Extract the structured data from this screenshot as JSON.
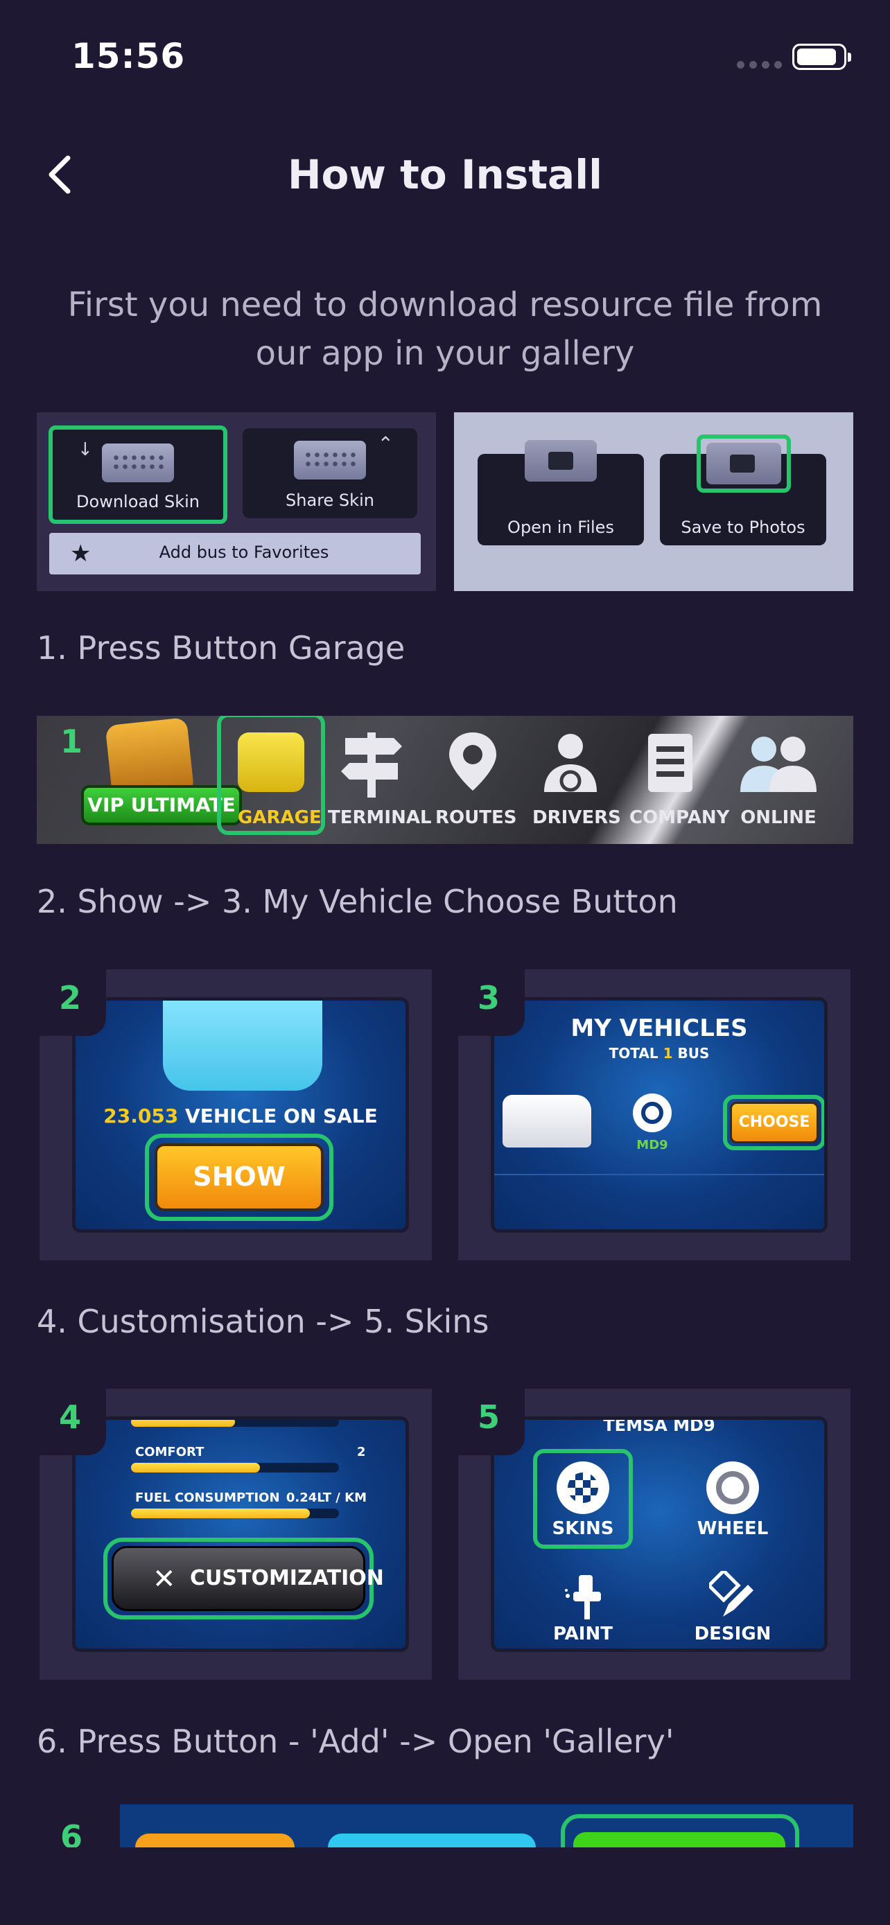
{
  "status_bar": {
    "time": "15:56"
  },
  "header": {
    "title": "How to Install",
    "back_icon": "chevron-left-icon"
  },
  "intro": "First you need to download resource file from our app in your gallery",
  "share_panel": {
    "download_label": "Download Skin",
    "share_label": "Share Skin",
    "favorites_label": "Add bus to Favorites"
  },
  "photo_panel": {
    "open_files_label": "Open in Files",
    "save_photos_label": "Save to Photos"
  },
  "steps": [
    {
      "heading": "1. Press Button Garage"
    },
    {
      "heading": "2. Show -> 3. My Vehicle Choose Button"
    },
    {
      "heading": "4. Customisation -> 5. Skins"
    },
    {
      "heading": "6. Press Button - 'Add' -> Open 'Gallery'"
    }
  ],
  "garage_strip": {
    "number": "1",
    "vip": "VIP ULTIMATE",
    "items": [
      "GARAGE",
      "TERMINAL",
      "ROUTES",
      "DRIVERS",
      "COMPANY",
      "ONLINE"
    ]
  },
  "shot2": {
    "number": "2",
    "count": "23.053",
    "sale_text": "VEHICLE ON SALE",
    "button": "SHOW"
  },
  "shot3": {
    "number": "3",
    "title": "MY VEHICLES",
    "total_prefix": "TOTAL",
    "total_count": "1",
    "total_suffix": "BUS",
    "model": "MD9",
    "button": "CHOOSE"
  },
  "shot4": {
    "number": "4",
    "comfort_label": "COMFORT",
    "comfort_value": "2",
    "comfort_level": 0.62,
    "fuel_label": "FUEL CONSUMPTION",
    "fuel_value": "0.24LT / KM",
    "fuel_level": 0.86,
    "button": "CUSTOMIZATION"
  },
  "shot5": {
    "number": "5",
    "title": "TEMSA MD9",
    "items": [
      "SKINS",
      "WHEEL",
      "PAINT",
      "DESIGN"
    ]
  },
  "shot6": {
    "number": "6"
  },
  "colors": {
    "background": "#1f1833",
    "highlight": "#27c46d",
    "accent_green": "#3fd077"
  }
}
